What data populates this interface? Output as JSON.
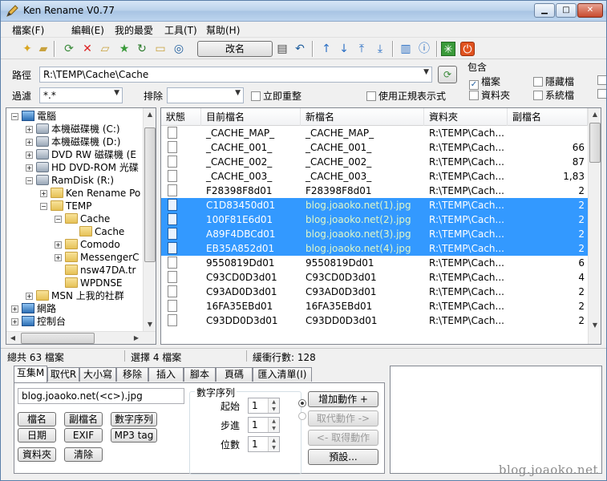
{
  "window": {
    "title": "Ken Rename V0.77"
  },
  "menu": [
    "檔案(F)",
    "編輯(E)",
    "我的最愛",
    "工具(T)",
    "幫助(H)"
  ],
  "toolbar": {
    "rename_label": "改名"
  },
  "path": {
    "label": "路徑",
    "value": "R:\\TEMP\\Cache\\Cache"
  },
  "filter": {
    "label": "過濾",
    "value": "*.*",
    "exclude_label": "排除",
    "exclude_value": "",
    "instant_label": "立即重整",
    "instant_checked": false,
    "regex_label": "使用正規表示式",
    "regex_checked": false
  },
  "include": {
    "title": "包含",
    "options": [
      {
        "label": "檔案",
        "checked": true
      },
      {
        "label": "隱藏檔",
        "checked": false
      },
      {
        "label": "資料夾",
        "checked": false
      },
      {
        "label": "系統檔",
        "checked": false
      }
    ]
  },
  "tree": [
    {
      "label": "電腦",
      "level": 0,
      "exp": "−",
      "icon": "computer-icon"
    },
    {
      "label": "本機磁碟機 (C:)",
      "level": 1,
      "exp": "+",
      "icon": "drive-icon"
    },
    {
      "label": "本機磁碟機 (D:)",
      "level": 1,
      "exp": "+",
      "icon": "drive-icon"
    },
    {
      "label": "DVD RW 磁碟機 (E",
      "level": 1,
      "exp": "+",
      "icon": "dvd-drive-icon"
    },
    {
      "label": "HD DVD-ROM 光碟",
      "level": 1,
      "exp": "+",
      "icon": "dvd-drive-icon"
    },
    {
      "label": "RamDisk (R:)",
      "level": 1,
      "exp": "−",
      "icon": "drive-icon"
    },
    {
      "label": "Ken Rename Po",
      "level": 2,
      "exp": "+",
      "icon": "folder-icon"
    },
    {
      "label": "TEMP",
      "level": 2,
      "exp": "−",
      "icon": "folder-icon"
    },
    {
      "label": "Cache",
      "level": 3,
      "exp": "−",
      "icon": "folder-icon"
    },
    {
      "label": "Cache",
      "level": 4,
      "exp": "",
      "icon": "folder-open-icon"
    },
    {
      "label": "Comodo",
      "level": 3,
      "exp": "+",
      "icon": "folder-icon"
    },
    {
      "label": "MessengerC",
      "level": 3,
      "exp": "+",
      "icon": "folder-icon"
    },
    {
      "label": "nsw47DA.tr",
      "level": 3,
      "exp": "",
      "icon": "folder-icon"
    },
    {
      "label": "WPDNSE",
      "level": 3,
      "exp": "",
      "icon": "folder-icon"
    },
    {
      "label": "MSN 上我的社群",
      "level": 1,
      "exp": "+",
      "icon": "folder-icon"
    },
    {
      "label": "網路",
      "level": 0,
      "exp": "+",
      "icon": "network-icon"
    },
    {
      "label": "控制台",
      "level": 0,
      "exp": "+",
      "icon": "control-panel-icon"
    }
  ],
  "list": {
    "columns": [
      "狀態",
      "目前檔名",
      "新檔名",
      "資料夾",
      "副檔名"
    ],
    "rows": [
      {
        "current": "_CACHE_MAP_",
        "new": "_CACHE_MAP_",
        "folder": "R:\\TEMP\\Cach...",
        "ext": "",
        "selected": false
      },
      {
        "current": "_CACHE_001_",
        "new": "_CACHE_001_",
        "folder": "R:\\TEMP\\Cach...",
        "ext": "66",
        "selected": false
      },
      {
        "current": "_CACHE_002_",
        "new": "_CACHE_002_",
        "folder": "R:\\TEMP\\Cach...",
        "ext": "87",
        "selected": false
      },
      {
        "current": "_CACHE_003_",
        "new": "_CACHE_003_",
        "folder": "R:\\TEMP\\Cach...",
        "ext": "1,83",
        "selected": false
      },
      {
        "current": "F28398F8d01",
        "new": "F28398F8d01",
        "folder": "R:\\TEMP\\Cach...",
        "ext": "2",
        "selected": false
      },
      {
        "current": "C1D83450d01",
        "new": "blog.joaoko.net(1).jpg",
        "folder": "R:\\TEMP\\Cach...",
        "ext": "2",
        "selected": true
      },
      {
        "current": "100F81E6d01",
        "new": "blog.joaoko.net(2).jpg",
        "folder": "R:\\TEMP\\Cach...",
        "ext": "2",
        "selected": true
      },
      {
        "current": "A89F4DBCd01",
        "new": "blog.joaoko.net(3).jpg",
        "folder": "R:\\TEMP\\Cach...",
        "ext": "2",
        "selected": true
      },
      {
        "current": "EB35A852d01",
        "new": "blog.joaoko.net(4).jpg",
        "folder": "R:\\TEMP\\Cach...",
        "ext": "2",
        "selected": true
      },
      {
        "current": "9550819Dd01",
        "new": "9550819Dd01",
        "folder": "R:\\TEMP\\Cach...",
        "ext": "6",
        "selected": false
      },
      {
        "current": "C93CD0D3d01",
        "new": "C93CD0D3d01",
        "folder": "R:\\TEMP\\Cach...",
        "ext": "4",
        "selected": false
      },
      {
        "current": "C93AD0D3d01",
        "new": "C93AD0D3d01",
        "folder": "R:\\TEMP\\Cach...",
        "ext": "2",
        "selected": false
      },
      {
        "current": "16FA35EBd01",
        "new": "16FA35EBd01",
        "folder": "R:\\TEMP\\Cach...",
        "ext": "2",
        "selected": false
      },
      {
        "current": "C93DD0D3d01",
        "new": "C93DD0D3d01",
        "folder": "R:\\TEMP\\Cach...",
        "ext": "2",
        "selected": false
      }
    ]
  },
  "status": {
    "total": "總共 63 檔案",
    "selected": "選擇 4 檔案",
    "buffer": "緩衝行數: 128"
  },
  "tabs": [
    "互集M",
    "取代R",
    "大小寫",
    "移除",
    "插入",
    "腳本",
    "頁碼",
    "匯入清單(I)"
  ],
  "insert_panel": {
    "pattern": "blog.joaoko.net(<c>).jpg",
    "buttons": [
      "檔名",
      "副檔名",
      "數字序列",
      "日期",
      "EXIF",
      "MP3 tag",
      "資料夾",
      "清除"
    ],
    "sequence": {
      "title": "數字序列",
      "start_label": "起始",
      "start": "1",
      "step_label": "步進",
      "step": "1",
      "digits_label": "位數",
      "digits": "1"
    },
    "actions": {
      "add": "增加動作 +",
      "replace": "取代動作 ->",
      "get": "<- 取得動作",
      "preset": "預設..."
    }
  },
  "watermark": "blog.joaoko.net"
}
